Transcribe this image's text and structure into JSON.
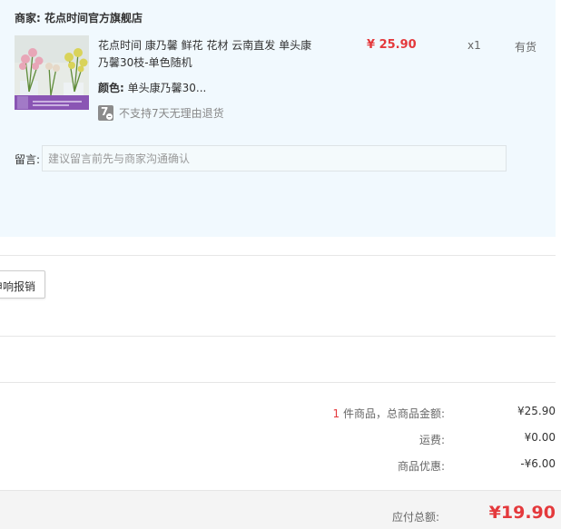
{
  "merchant": {
    "label": "商家:",
    "name": "花点时间官方旗舰店"
  },
  "product": {
    "image_icon": "flower-bouquet-thumbnail",
    "title_line1": "花点时间 康乃馨 鲜花 花材 云南直发 单头康",
    "title_line2": "乃馨30枝-单色随机",
    "option_label": "颜色:",
    "option_value": "单头康乃馨30...",
    "price": "¥ 25.90",
    "quantity": "x1",
    "stock": "有货",
    "return_badge": "7",
    "return_policy": "不支持7天无理由退货"
  },
  "remark": {
    "label": "留言:",
    "placeholder": "建议留言前先与商家沟通确认"
  },
  "invoice": {
    "button_label": "申响报销"
  },
  "summary": {
    "count": "1",
    "items_label": "件商品，总商品金额:",
    "items_total": "¥25.90",
    "shipping_label": "运费:",
    "shipping_value": "¥0.00",
    "discount_label": "商品优惠:",
    "discount_value": "-¥6.00"
  },
  "total": {
    "label": "应付总额:",
    "value": "¥19.90"
  },
  "colors": {
    "accent_red": "#e4393c",
    "panel_blue": "#f1f9fe"
  }
}
